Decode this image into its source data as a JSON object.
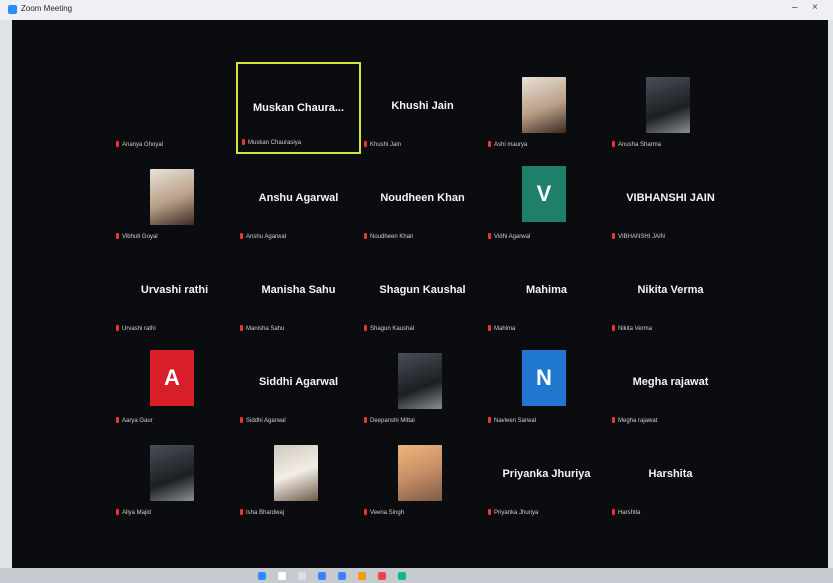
{
  "window": {
    "title": "Zoom Meeting",
    "colors": {
      "frame": "#eef0f3",
      "stage": "#0b0c10",
      "active_border": "#d8e23a",
      "mic_muted": "#e33"
    }
  },
  "participants": [
    {
      "label": "Ananya Ghoyal",
      "display": "",
      "kind": "blank"
    },
    {
      "label": "Muskan Chaurasiya",
      "display": "Muskan Chaura...",
      "kind": "name",
      "active": true
    },
    {
      "label": "Khushi Jain",
      "display": "Khushi Jain",
      "kind": "name"
    },
    {
      "label": "Ashi maurya",
      "display": "",
      "kind": "photo"
    },
    {
      "label": "Anusha Sharma",
      "display": "",
      "kind": "photo-dark"
    },
    {
      "label": "Vibhuti Goyal",
      "display": "",
      "kind": "photo"
    },
    {
      "label": "Anshu Agarwal",
      "display": "Anshu Agarwal",
      "kind": "name"
    },
    {
      "label": "Noudheen Khan",
      "display": "Noudheen Khan",
      "kind": "name"
    },
    {
      "label": "Vidhi Agarwal",
      "display": "V",
      "kind": "letter",
      "color": "#1f7f6a"
    },
    {
      "label": "VIBHANSHI JAIN",
      "display": "VIBHANSHI JAIN",
      "kind": "name"
    },
    {
      "label": "Urvashi rathi",
      "display": "Urvashi rathi",
      "kind": "name"
    },
    {
      "label": "Manisha Sahu",
      "display": "Manisha Sahu",
      "kind": "name"
    },
    {
      "label": "Shagun Kaushal",
      "display": "Shagun Kaushal",
      "kind": "name"
    },
    {
      "label": "Mahima",
      "display": "Mahima",
      "kind": "name"
    },
    {
      "label": "Nikita Verma",
      "display": "Nikita Verma",
      "kind": "name"
    },
    {
      "label": "Aarya Gaur",
      "display": "A",
      "kind": "letter",
      "color": "#d81e28"
    },
    {
      "label": "Siddhi Agarwal",
      "display": "Siddhi Agarwal",
      "kind": "name"
    },
    {
      "label": "Deepanshi Mittal",
      "display": "",
      "kind": "photo-dark"
    },
    {
      "label": "Navleen Sarwal",
      "display": "N",
      "kind": "letter",
      "color": "#1f77d0"
    },
    {
      "label": "Megha rajawat",
      "display": "Megha rajawat",
      "kind": "name"
    },
    {
      "label": "Aliya Majid",
      "display": "",
      "kind": "photo-dark"
    },
    {
      "label": "Isha Bhardwaj",
      "display": "",
      "kind": "photo-plain"
    },
    {
      "label": "Veena Singh",
      "display": "",
      "kind": "photo-sunset"
    },
    {
      "label": "Priyanka Jhuriya",
      "display": "Priyanka Jhuriya",
      "kind": "name"
    },
    {
      "label": "Harshita",
      "display": "Harshita",
      "kind": "name"
    }
  ],
  "icons": [
    "zoom-app-icon",
    "minimize-icon",
    "maximize-icon",
    "close-icon",
    "mic-muted-icon"
  ]
}
